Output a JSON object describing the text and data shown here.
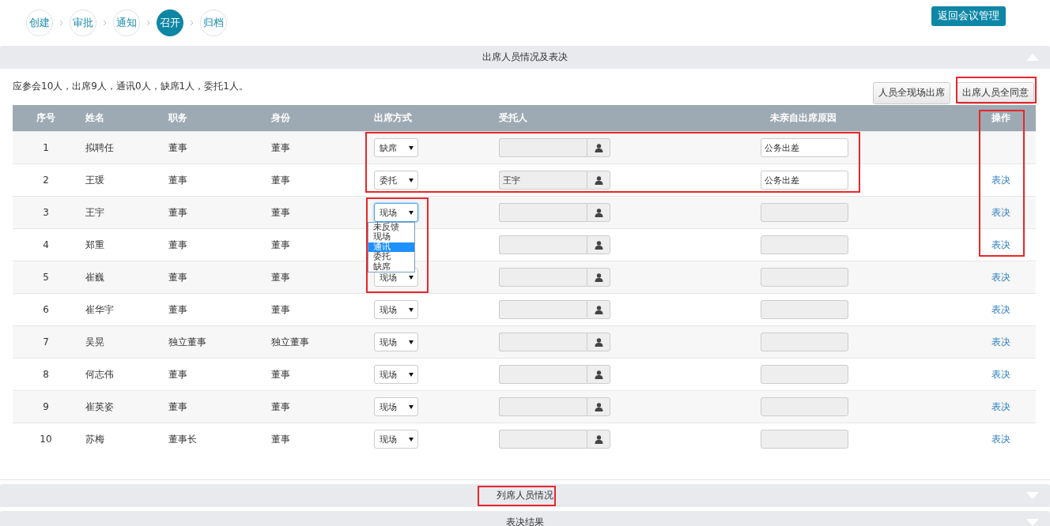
{
  "steps": [
    {
      "label": "创建",
      "selected": false
    },
    {
      "label": "审批",
      "selected": false
    },
    {
      "label": "通知",
      "selected": false
    },
    {
      "label": "召开",
      "selected": true
    },
    {
      "label": "归档",
      "selected": false
    }
  ],
  "return_button": "返回会议管理",
  "attendance_section": {
    "title": "出席人员情况及表决",
    "expanded": true,
    "summary": "应参会10人，出席9人，通讯0人，缺席1人，委托1人。",
    "buttons": [
      "人员全现场出席",
      "出席人员全同意"
    ],
    "columns": [
      "序号",
      "姓名",
      "职务",
      "身份",
      "出席方式",
      "受托人",
      "未亲自出席原因",
      "操作"
    ],
    "rows": [
      {
        "no": "1",
        "name": "拟聘任",
        "position": "董事",
        "role": "董事",
        "attendance": "缺席",
        "focused": false,
        "reason": "公务出差",
        "reason_disabled": false
      },
      {
        "no": "2",
        "name": "王瑗",
        "position": "董事",
        "role": "董事",
        "attendance": "委托",
        "focused": false,
        "delegate": "王宇",
        "reason": "公务出差",
        "reason_disabled": false,
        "action": "表决"
      },
      {
        "no": "3",
        "name": "王宇",
        "position": "董事",
        "role": "董事",
        "attendance": "现场",
        "focused": true,
        "options": [
          {
            "label": "未反馈",
            "selected": false
          },
          {
            "label": "现场",
            "selected": false
          },
          {
            "label": "通讯",
            "selected": true
          },
          {
            "label": "委托",
            "selected": false
          },
          {
            "label": "缺席",
            "selected": false
          }
        ],
        "reason_disabled": true,
        "action": "表决"
      },
      {
        "no": "4",
        "name": "郑重",
        "position": "董事",
        "role": "董事",
        "reason_disabled": true,
        "action": "表决"
      },
      {
        "no": "5",
        "name": "崔巍",
        "position": "董事",
        "role": "董事",
        "attendance": "现场",
        "focused": false,
        "reason_disabled": true,
        "action": "表决"
      },
      {
        "no": "6",
        "name": "崔华宇",
        "position": "董事",
        "role": "董事",
        "attendance": "现场",
        "focused": false,
        "reason_disabled": true,
        "action": "表决"
      },
      {
        "no": "7",
        "name": "吴晃",
        "position": "独立董事",
        "role": "独立董事",
        "attendance": "现场",
        "focused": false,
        "reason_disabled": true,
        "action": "表决"
      },
      {
        "no": "8",
        "name": "何志伟",
        "position": "董事",
        "role": "董事",
        "attendance": "现场",
        "focused": false,
        "reason_disabled": true,
        "action": "表决"
      },
      {
        "no": "9",
        "name": "崔英姿",
        "position": "董事",
        "role": "董事",
        "attendance": "现场",
        "focused": false,
        "reason_disabled": true,
        "action": "表决"
      },
      {
        "no": "10",
        "name": "苏梅",
        "position": "董事长",
        "role": "董事",
        "attendance": "现场",
        "focused": false,
        "reason_disabled": true,
        "action": "表决"
      }
    ]
  },
  "collapsed_sections": [
    {
      "title": "列席人员情况",
      "expanded": false
    },
    {
      "title": "表决结果",
      "expanded": false
    }
  ],
  "annotation_frames": [
    {
      "kind": "button"
    },
    {
      "kind": "operation-column"
    },
    {
      "kind": "row-fields"
    },
    {
      "kind": "dropdown"
    },
    {
      "kind": "section-title"
    }
  ]
}
